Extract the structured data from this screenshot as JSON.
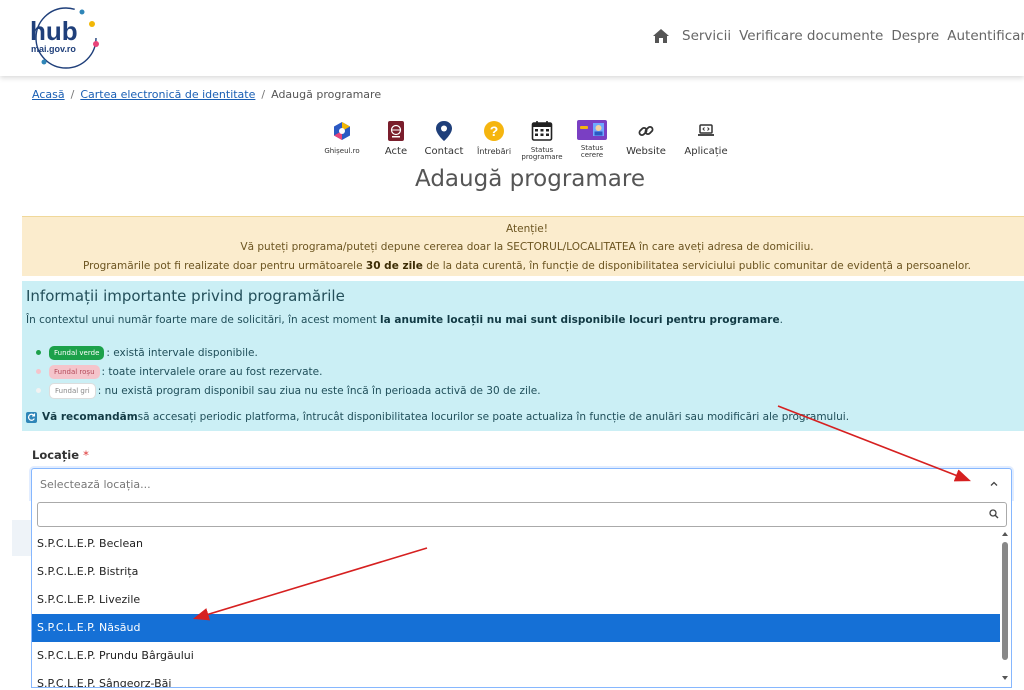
{
  "header": {
    "logo_text": "hub",
    "logo_subtext": "mai.gov.ro",
    "nav": [
      "Servicii",
      "Verificare documente",
      "Despre",
      "Autentificare"
    ]
  },
  "breadcrumb": {
    "home": "Acasă",
    "parent": "Cartea electronică de identitate",
    "current": "Adaugă programare"
  },
  "quick_links": [
    {
      "label": "Ghișeul.ro",
      "icon": "ghiseul-icon"
    },
    {
      "label": "Acte",
      "icon": "passport-icon"
    },
    {
      "label": "Contact",
      "icon": "location-pin-icon"
    },
    {
      "label": "Întrebări",
      "icon": "question-icon"
    },
    {
      "label": "Status programare",
      "icon": "calendar-icon"
    },
    {
      "label": "Status cerere",
      "icon": "id-card-icon"
    },
    {
      "label": "Website",
      "icon": "link-icon"
    },
    {
      "label": "Aplicație",
      "icon": "laptop-icon"
    }
  ],
  "page_title": "Adaugă programare",
  "warning": {
    "heading": "Atenție!",
    "line1": "Vă puteți programa/puteți depune cererea doar la SECTORUL/LOCALITATEA în care aveți adresa de domiciliu.",
    "line2_pre": "Programările pot fi realizate doar pentru următoarele ",
    "line2_bold": "30 de zile",
    "line2_post": " de la data curentă, în funcție de disponibilitatea serviciului public comunitar de evidență a persoanelor."
  },
  "info": {
    "title": "Informații importante privind programările",
    "context_pre": "În contextul unui număr foarte mare de solicitări, în acest moment ",
    "context_bold": "la anumite locații nu mai sunt disponibile locuri pentru programare",
    "context_post": ".",
    "legend": [
      {
        "tag": "Fundal verde",
        "text": ": există intervale disponibile."
      },
      {
        "tag": "Fundal roșu",
        "text": ": toate intervalele orare au fost rezervate."
      },
      {
        "tag": "Fundal gri",
        "text": ": nu există program disponibil sau ziua nu este încă în perioada activă de 30 de zile."
      }
    ],
    "recommend_bold": "Vă recomandăm",
    "recommend_text": " să accesați periodic platforma, întrucât disponibilitatea locurilor se poate actualiza în funcție de anulări sau modificări ale programului."
  },
  "location": {
    "label": "Locație",
    "required_mark": "*",
    "placeholder": "Selectează locația...",
    "search_value": "",
    "options": [
      "S.P.C.L.E.P. Beclean",
      "S.P.C.L.E.P. Bistrița",
      "S.P.C.L.E.P. Livezile",
      "S.P.C.L.E.P. Năsăud",
      "S.P.C.L.E.P. Prundu Bârgăului",
      "S.P.C.L.E.P. Sângeorz-Băi"
    ],
    "selected_index": 3
  },
  "colors": {
    "accent": "#1570d6",
    "warning_bg": "#fbeccd",
    "info_bg": "#cbeff5",
    "annotation": "#d62020"
  }
}
